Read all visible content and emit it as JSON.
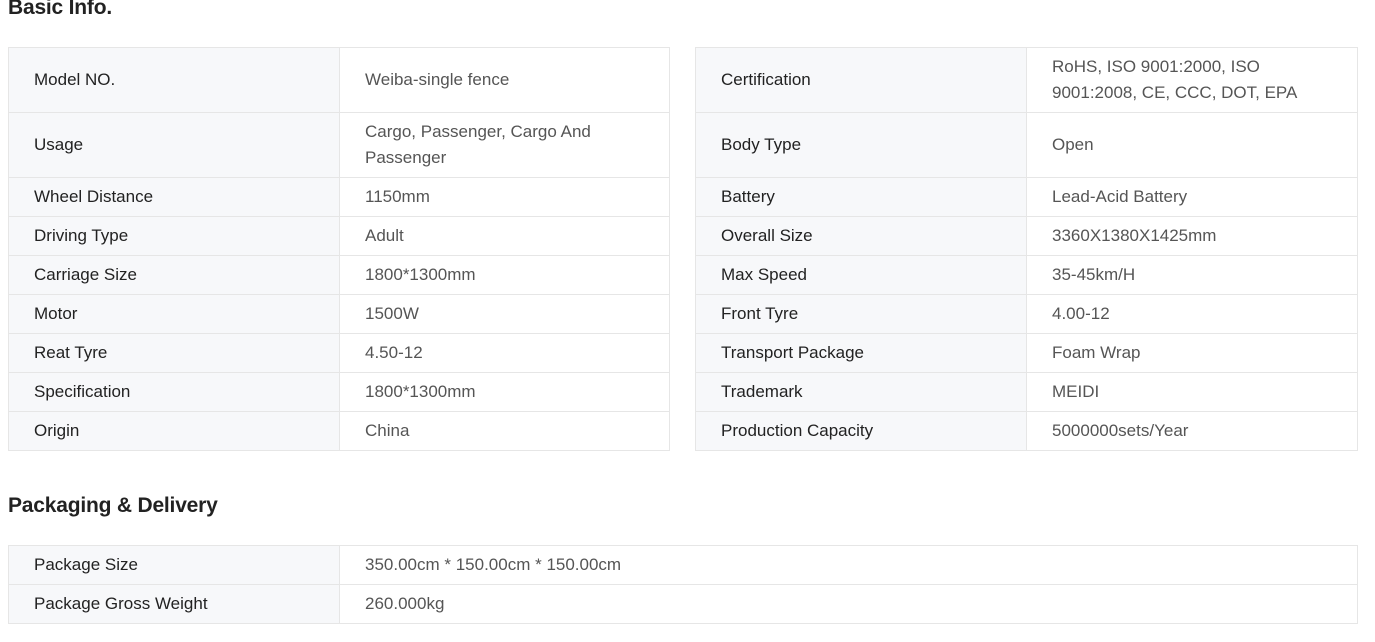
{
  "basic_info": {
    "title": "Basic Info.",
    "left": [
      {
        "label": "Model NO.",
        "value": "Weiba-single fence"
      },
      {
        "label": "Usage",
        "value": "Cargo, Passenger, Cargo And Passenger"
      },
      {
        "label": "Wheel Distance",
        "value": "1150mm"
      },
      {
        "label": "Driving Type",
        "value": "Adult"
      },
      {
        "label": "Carriage Size",
        "value": "1800*1300mm"
      },
      {
        "label": "Motor",
        "value": "1500W"
      },
      {
        "label": "Reat Tyre",
        "value": "4.50-12"
      },
      {
        "label": "Specification",
        "value": "1800*1300mm"
      },
      {
        "label": "Origin",
        "value": "China"
      }
    ],
    "right": [
      {
        "label": "Certification",
        "value": "RoHS, ISO 9001:2000, ISO 9001:2008, CE, CCC, DOT, EPA"
      },
      {
        "label": "Body Type",
        "value": "Open"
      },
      {
        "label": "Battery",
        "value": "Lead-Acid Battery"
      },
      {
        "label": "Overall Size",
        "value": "3360X1380X1425mm"
      },
      {
        "label": "Max Speed",
        "value": "35-45km/H"
      },
      {
        "label": "Front Tyre",
        "value": "4.00-12"
      },
      {
        "label": "Transport Package",
        "value": "Foam Wrap"
      },
      {
        "label": "Trademark",
        "value": "MEIDI"
      },
      {
        "label": "Production Capacity",
        "value": "5000000sets/Year"
      }
    ]
  },
  "packaging": {
    "title": "Packaging & Delivery",
    "rows": [
      {
        "label": "Package Size",
        "value": "350.00cm * 150.00cm * 150.00cm"
      },
      {
        "label": "Package Gross Weight",
        "value": "260.000kg"
      }
    ]
  }
}
